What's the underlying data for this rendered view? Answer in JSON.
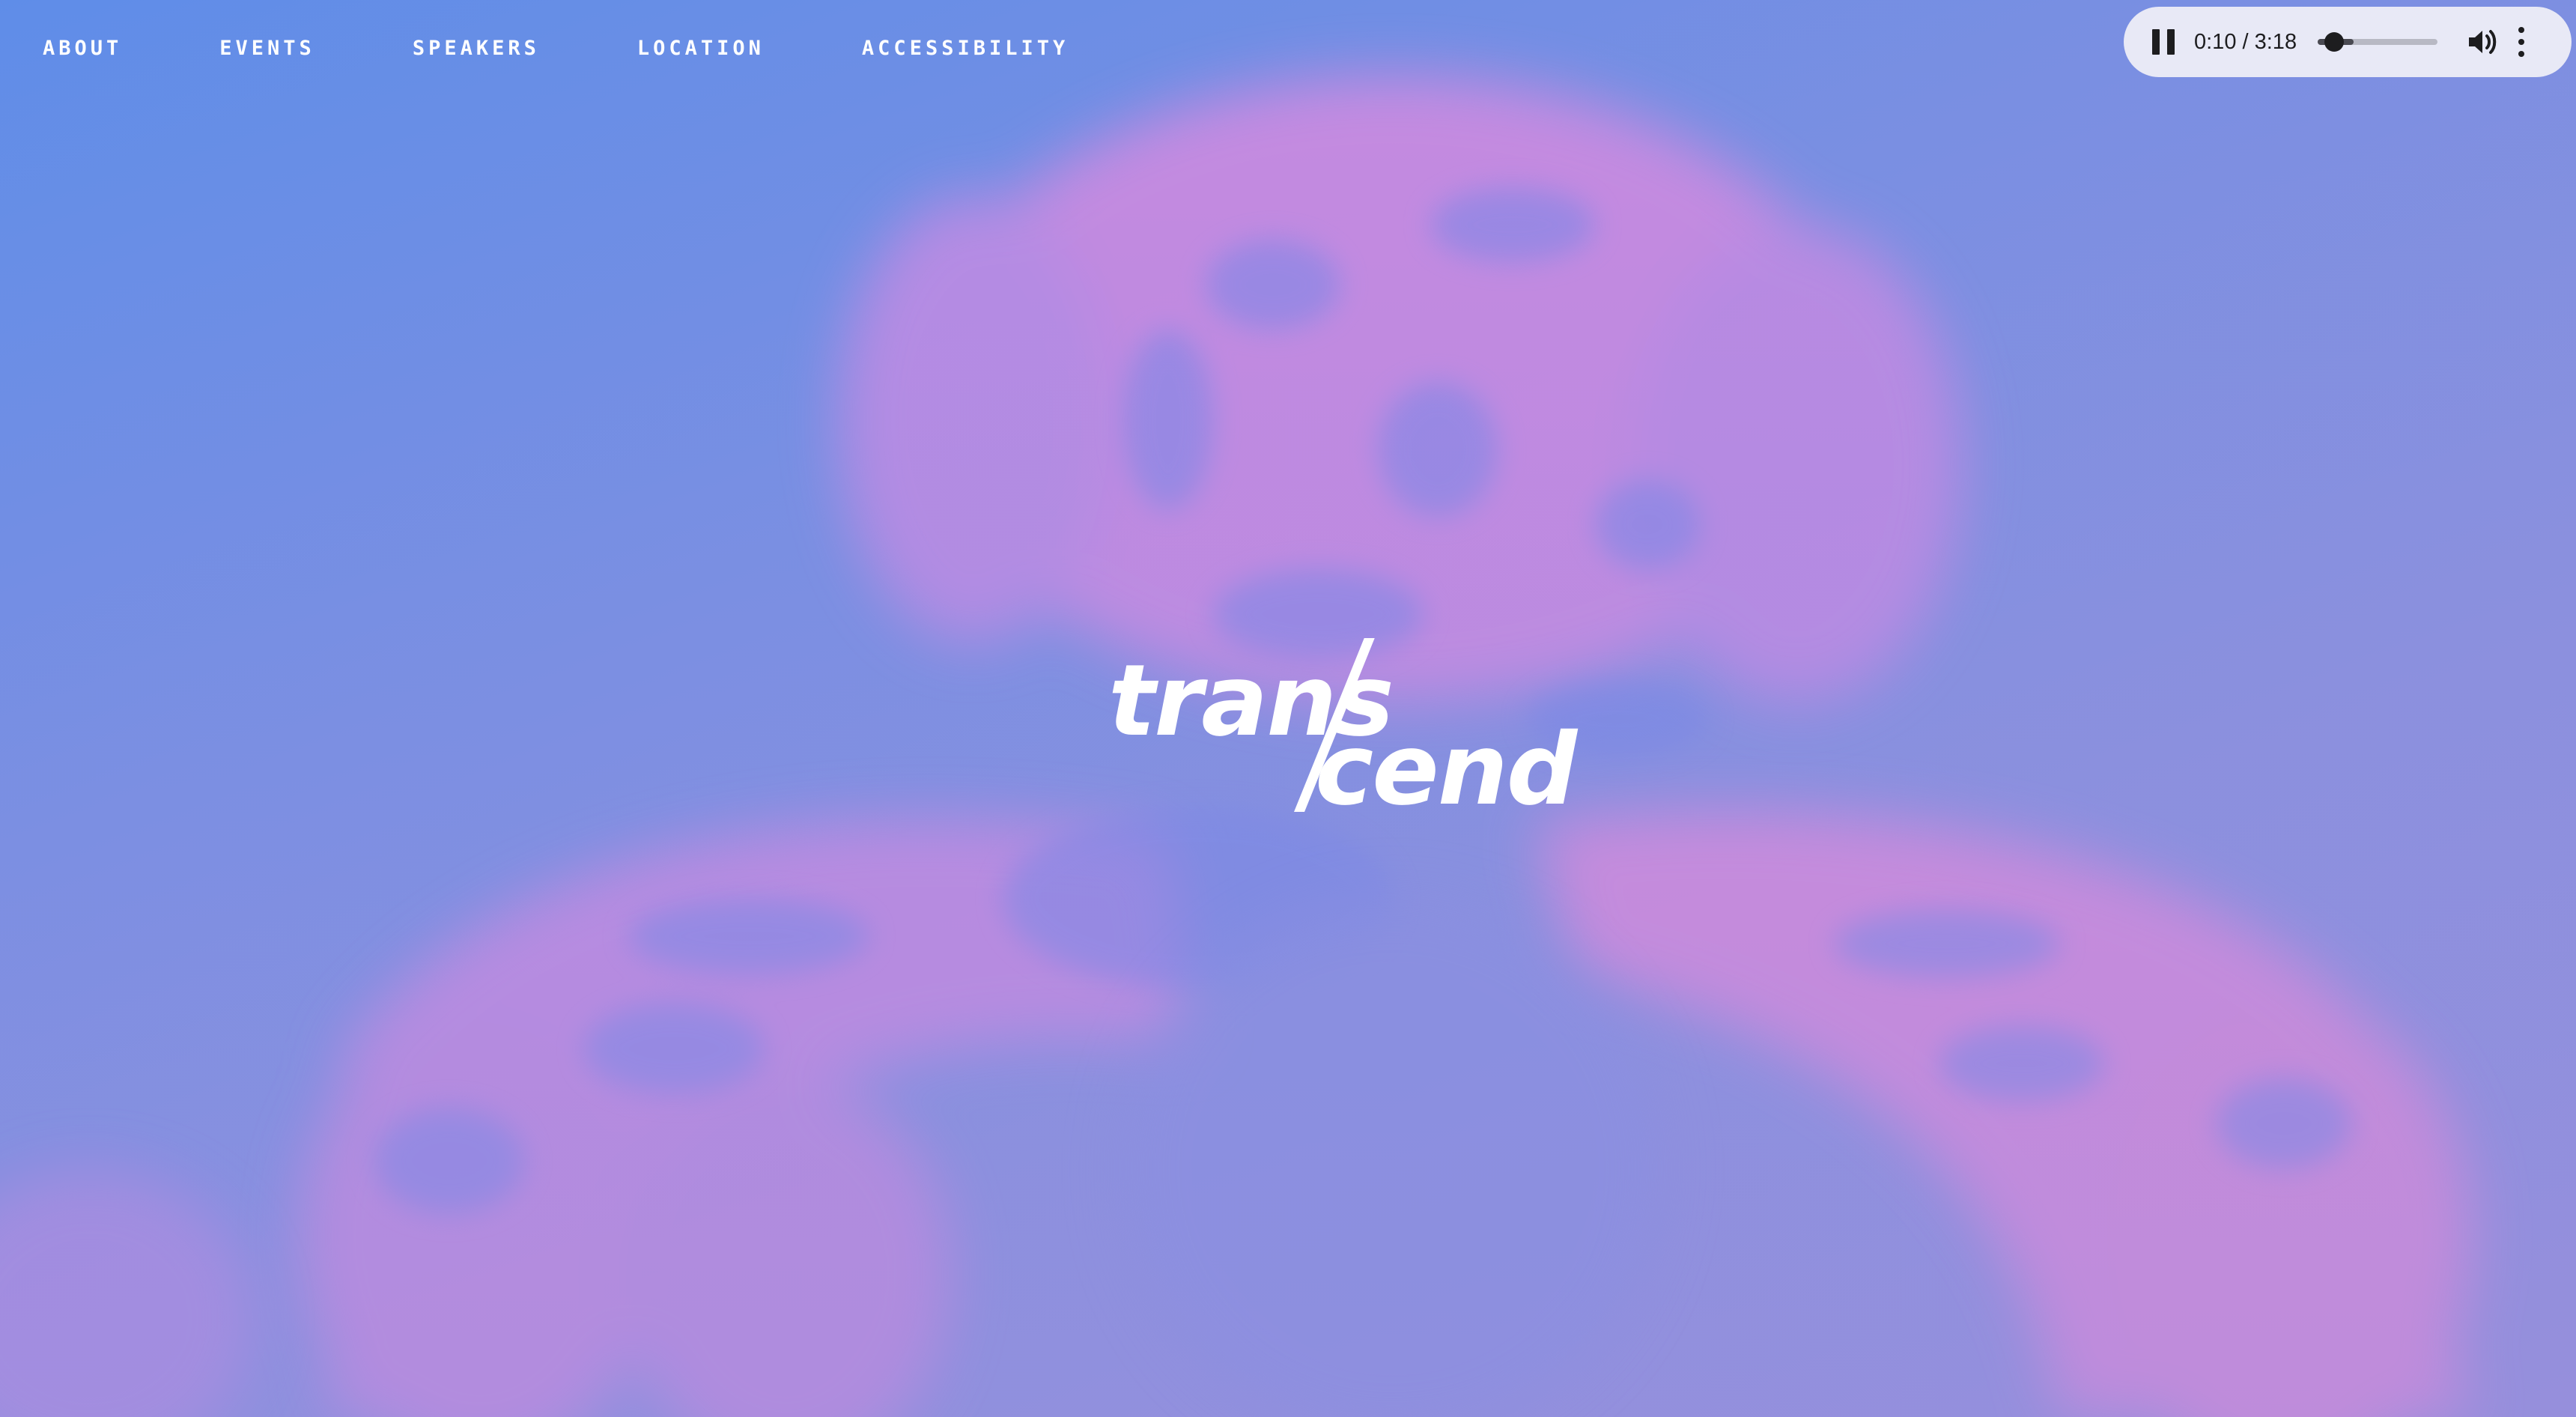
{
  "nav": {
    "items": [
      {
        "label": "ABOUT"
      },
      {
        "label": "EVENTS"
      },
      {
        "label": "SPEAKERS"
      },
      {
        "label": "LOCATION"
      },
      {
        "label": "ACCESSIBILITY"
      }
    ]
  },
  "player": {
    "current_time": "0:10",
    "separator": " / ",
    "duration": "3:18",
    "progress": 0.05,
    "state": "playing",
    "pause_icon": "pause-icon",
    "volume_icon": "volume-icon",
    "more_icon": "more-vertical-icon"
  },
  "logo": {
    "part1": "trans",
    "part2": "cend"
  },
  "colors": {
    "background_top": "#5f8de8",
    "background_bottom": "#9a8fda",
    "blob_pink": "#e28ad8",
    "text": "#ffffff",
    "player_bg": "#e8e9f6"
  }
}
